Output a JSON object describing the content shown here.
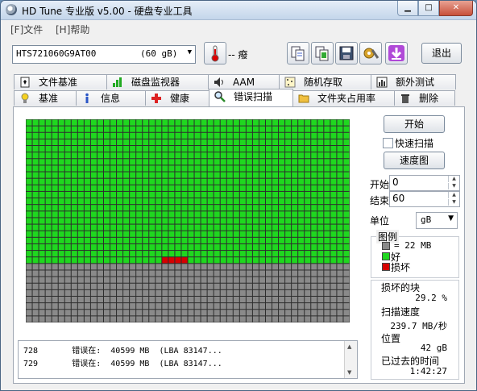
{
  "window": {
    "title": "HD Tune 专业版 v5.00 - 硬盘专业工具"
  },
  "menu": [
    {
      "label": "[F]文件"
    },
    {
      "label": "[H]帮助"
    }
  ],
  "toolbar": {
    "drive_name": "HTS721060G9AT00",
    "drive_capacity": "(60 gB)",
    "temperature": "-- 癈",
    "exit_label": "退出",
    "buttons": [
      "copy-icon",
      "copy-info-icon",
      "save-icon",
      "settings-icon",
      "download-icon"
    ]
  },
  "tabs_top": [
    {
      "label": "文件基准",
      "icon": "file-benchmark-icon"
    },
    {
      "label": "磁盘监视器",
      "icon": "disk-monitor-icon"
    },
    {
      "label": "AAM",
      "icon": "speaker-icon"
    },
    {
      "label": "随机存取",
      "icon": "random-access-icon"
    },
    {
      "label": "额外测试",
      "icon": "extra-tests-icon"
    }
  ],
  "tabs_bottom": [
    {
      "label": "基准",
      "icon": "lightbulb-icon"
    },
    {
      "label": "信息",
      "icon": "info-icon"
    },
    {
      "label": "健康",
      "icon": "health-cross-icon"
    },
    {
      "label": "错误扫描",
      "icon": "magnifier-icon",
      "active": true
    },
    {
      "label": "文件夹占用率",
      "icon": "folder-icon"
    },
    {
      "label": "删除",
      "icon": "trash-icon"
    }
  ],
  "scan": {
    "start_label": "开始",
    "quick_scan_label": "快速扫描",
    "quick_scan_checked": false,
    "speed_map_label": "速度图",
    "start_field_label": "开始",
    "start_value": "0",
    "end_field_label": "结束",
    "end_value": "60",
    "unit_label": "单位",
    "unit_value": "gB",
    "legend_title": "图例",
    "legend_block": "= 22 MB",
    "legend_good": "好",
    "legend_bad": "损坏",
    "bad_blocks_label": "损坏的块",
    "bad_blocks_value": "29.2 %",
    "scan_speed_label": "扫描速度",
    "scan_speed_value": "239.7 MB/秒",
    "position_label": "位置",
    "position_value": "42 gB",
    "elapsed_label": "已过去的时间",
    "elapsed_value": "1:42:27"
  },
  "grid_summary": {
    "columns": 50,
    "rows": 31,
    "scanned_rows_complete": 22,
    "scanned_cells_last_row": 0,
    "bad_blocks_row": 21,
    "bad_blocks_columns": [
      21,
      22,
      23,
      24
    ],
    "colors": {
      "good": "#1fd71f",
      "bad": "#d60000",
      "unscanned": "#8a8a8a",
      "gridline": "#2d2d2d"
    }
  },
  "log": [
    {
      "id": "728",
      "text": "错误在:  40599 MB  (LBA 83147..."
    },
    {
      "id": "729",
      "text": "错误在:  40599 MB  (LBA 83147..."
    }
  ]
}
